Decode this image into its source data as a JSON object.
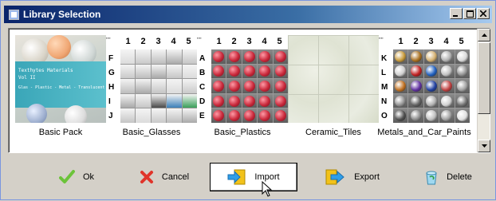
{
  "window": {
    "title": "Library Selection"
  },
  "library_items": [
    {
      "caption": "Basic Pack",
      "banner_lines": [
        "Texthytes Materials",
        "Vol II",
        "Glas - Plastic - Metal - Translucent"
      ]
    },
    {
      "caption": "Basic_Glasses",
      "rows": [
        "F",
        "G",
        "H",
        "I",
        "J"
      ]
    },
    {
      "caption": "Basic_Plastics",
      "rows": [
        "A",
        "B",
        "C",
        "D",
        "E"
      ]
    },
    {
      "caption": "Ceramic_Tiles"
    },
    {
      "caption": "Metals_and_Car_Paints",
      "rows": [
        "K",
        "L",
        "M",
        "N",
        "O"
      ]
    }
  ],
  "grid_columns": [
    "1",
    "2",
    "3",
    "4",
    "5"
  ],
  "buttons": {
    "ok": "Ok",
    "cancel": "Cancel",
    "import": "Import",
    "export": "Export",
    "delete": "Delete"
  },
  "colors": {
    "titlebar_start": "#0a246a",
    "titlebar_end": "#a6caf0",
    "face": "#d4d0c8",
    "plastic_red": "#c8283a",
    "import_arrow": "#2f9ee8",
    "import_box": "#f2c21a"
  }
}
